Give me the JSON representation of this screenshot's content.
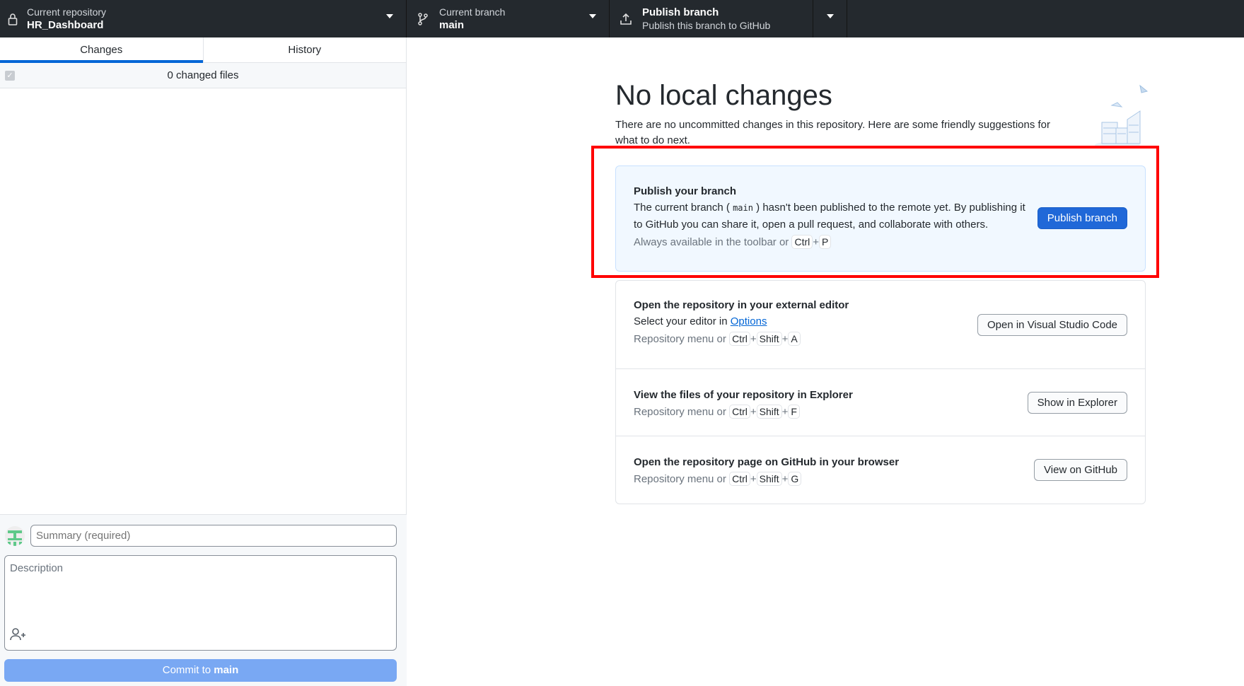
{
  "toolbar": {
    "repository": {
      "label": "Current repository",
      "value": "HR_Dashboard"
    },
    "branch": {
      "label": "Current branch",
      "value": "main"
    },
    "publish": {
      "label": "Publish branch",
      "description": "Publish this branch to GitHub"
    }
  },
  "sidebar": {
    "tabs": [
      {
        "label": "Changes",
        "active": true
      },
      {
        "label": "History",
        "active": false
      }
    ],
    "changed_files": "0 changed files",
    "commit": {
      "summary_placeholder": "Summary (required)",
      "description_placeholder": "Description",
      "button_prefix": "Commit to ",
      "button_branch": "main"
    }
  },
  "main": {
    "title": "No local changes",
    "intro": "There are no uncommitted changes in this repository. Here are some friendly suggestions for what to do next.",
    "publish_card": {
      "title": "Publish your branch",
      "text_before": "The current branch (",
      "branch": "main",
      "text_after": ") hasn't been published to the remote yet. By publishing it to GitHub you can share it, open a pull request, and collaborate with others.",
      "shortcut_text": "Always available in the toolbar or",
      "keys": [
        "Ctrl",
        "P"
      ],
      "button": "Publish branch"
    },
    "editor_card": {
      "title": "Open the repository in your external editor",
      "text": "Select your editor in",
      "link": "Options",
      "shortcut_text": "Repository menu or",
      "keys": [
        "Ctrl",
        "Shift",
        "A"
      ],
      "button": "Open in Visual Studio Code"
    },
    "explorer_card": {
      "title": "View the files of your repository in Explorer",
      "shortcut_text": "Repository menu or",
      "keys": [
        "Ctrl",
        "Shift",
        "F"
      ],
      "button": "Show in Explorer"
    },
    "github_card": {
      "title": "Open the repository page on GitHub in your browser",
      "shortcut_text": "Repository menu or",
      "keys": [
        "Ctrl",
        "Shift",
        "G"
      ],
      "button": "View on GitHub"
    },
    "plus": "+"
  },
  "colors": {
    "accent": "#0366d6",
    "highlight": "#ff0000",
    "toolbar_bg": "#24292e"
  }
}
